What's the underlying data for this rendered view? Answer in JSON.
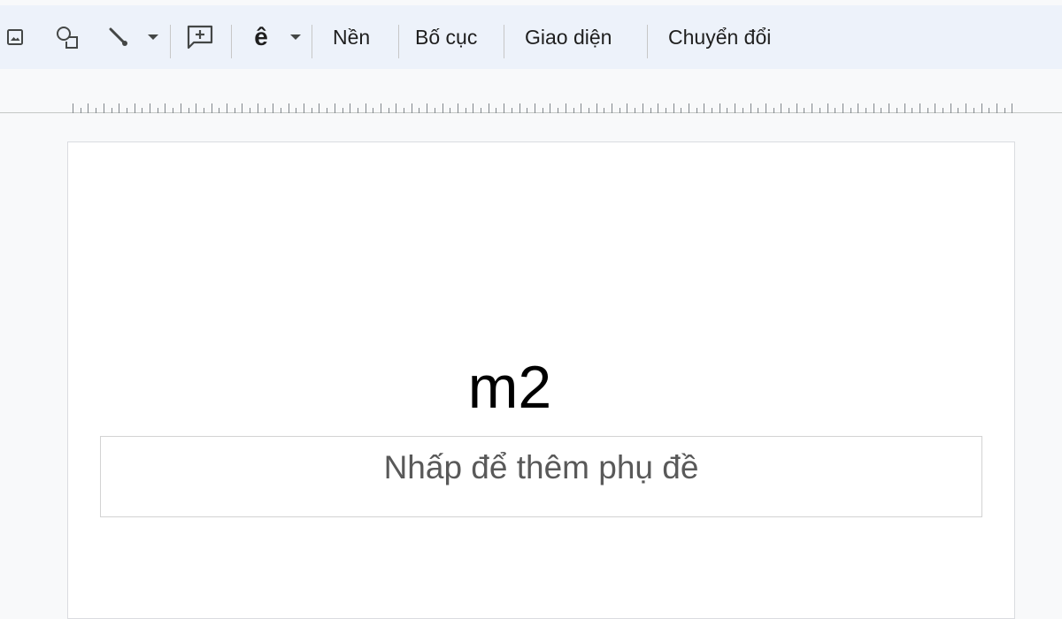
{
  "toolbar": {
    "icons": [
      "image-icon",
      "shapes-icon",
      "line-icon",
      "chevron-down-icon",
      "comment-icon",
      "text-style-icon",
      "chevron-down-icon"
    ],
    "text_style_glyph": "ê",
    "buttons": {
      "background": "Nền",
      "layout": "Bố cục",
      "theme": "Giao diện",
      "transition": "Chuyển đổi"
    }
  },
  "slide": {
    "title": "m2",
    "subtitle_placeholder": "Nhấp để thêm phụ đề"
  },
  "colors": {
    "toolbar_bg": "#edf2fa",
    "canvas_bg": "#f8f9fa",
    "slide_bg": "#ffffff"
  }
}
